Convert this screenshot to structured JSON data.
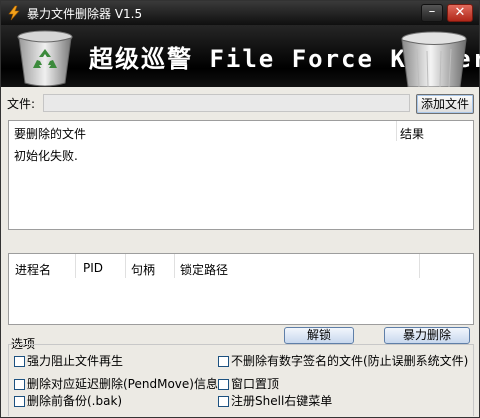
{
  "window": {
    "title": "暴力文件删除器 V1.5",
    "minimize_label": "–",
    "close_label": "✕"
  },
  "banner": {
    "title": "超级巡警 File Force Killer"
  },
  "file_row": {
    "label": "文件:",
    "value": "",
    "add_button": "添加文件"
  },
  "delete_list": {
    "headers": [
      "要删除的文件",
      "结果"
    ],
    "rows": [
      {
        "file": "初始化失败.",
        "result": ""
      }
    ]
  },
  "process_list": {
    "headers": [
      "进程名",
      "PID",
      "句柄",
      "锁定路径"
    ]
  },
  "actions": {
    "unlock": "解锁",
    "force_delete": "暴力删除"
  },
  "options": {
    "label": "选项",
    "items": [
      {
        "label": "强力阻止文件再生",
        "checked": false
      },
      {
        "label": "不删除有数字签名的文件(防止误删系统文件)",
        "checked": false
      },
      {
        "label": "删除对应延迟删除(PendMove)信息",
        "checked": false
      },
      {
        "label": "窗口置顶",
        "checked": false
      },
      {
        "label": "删除前备份(.bak)",
        "checked": false
      },
      {
        "label": "注册Shell右键菜单",
        "checked": false
      }
    ]
  },
  "icons": {
    "app": "lightning-icon",
    "banner_left": "recycle-bin-icon",
    "banner_right": "trash-can-icon"
  },
  "colors": {
    "titlebar": "#0f0f0f",
    "close": "#c0392b",
    "banner": "#000000",
    "button_blue": "#c8d8ee"
  }
}
